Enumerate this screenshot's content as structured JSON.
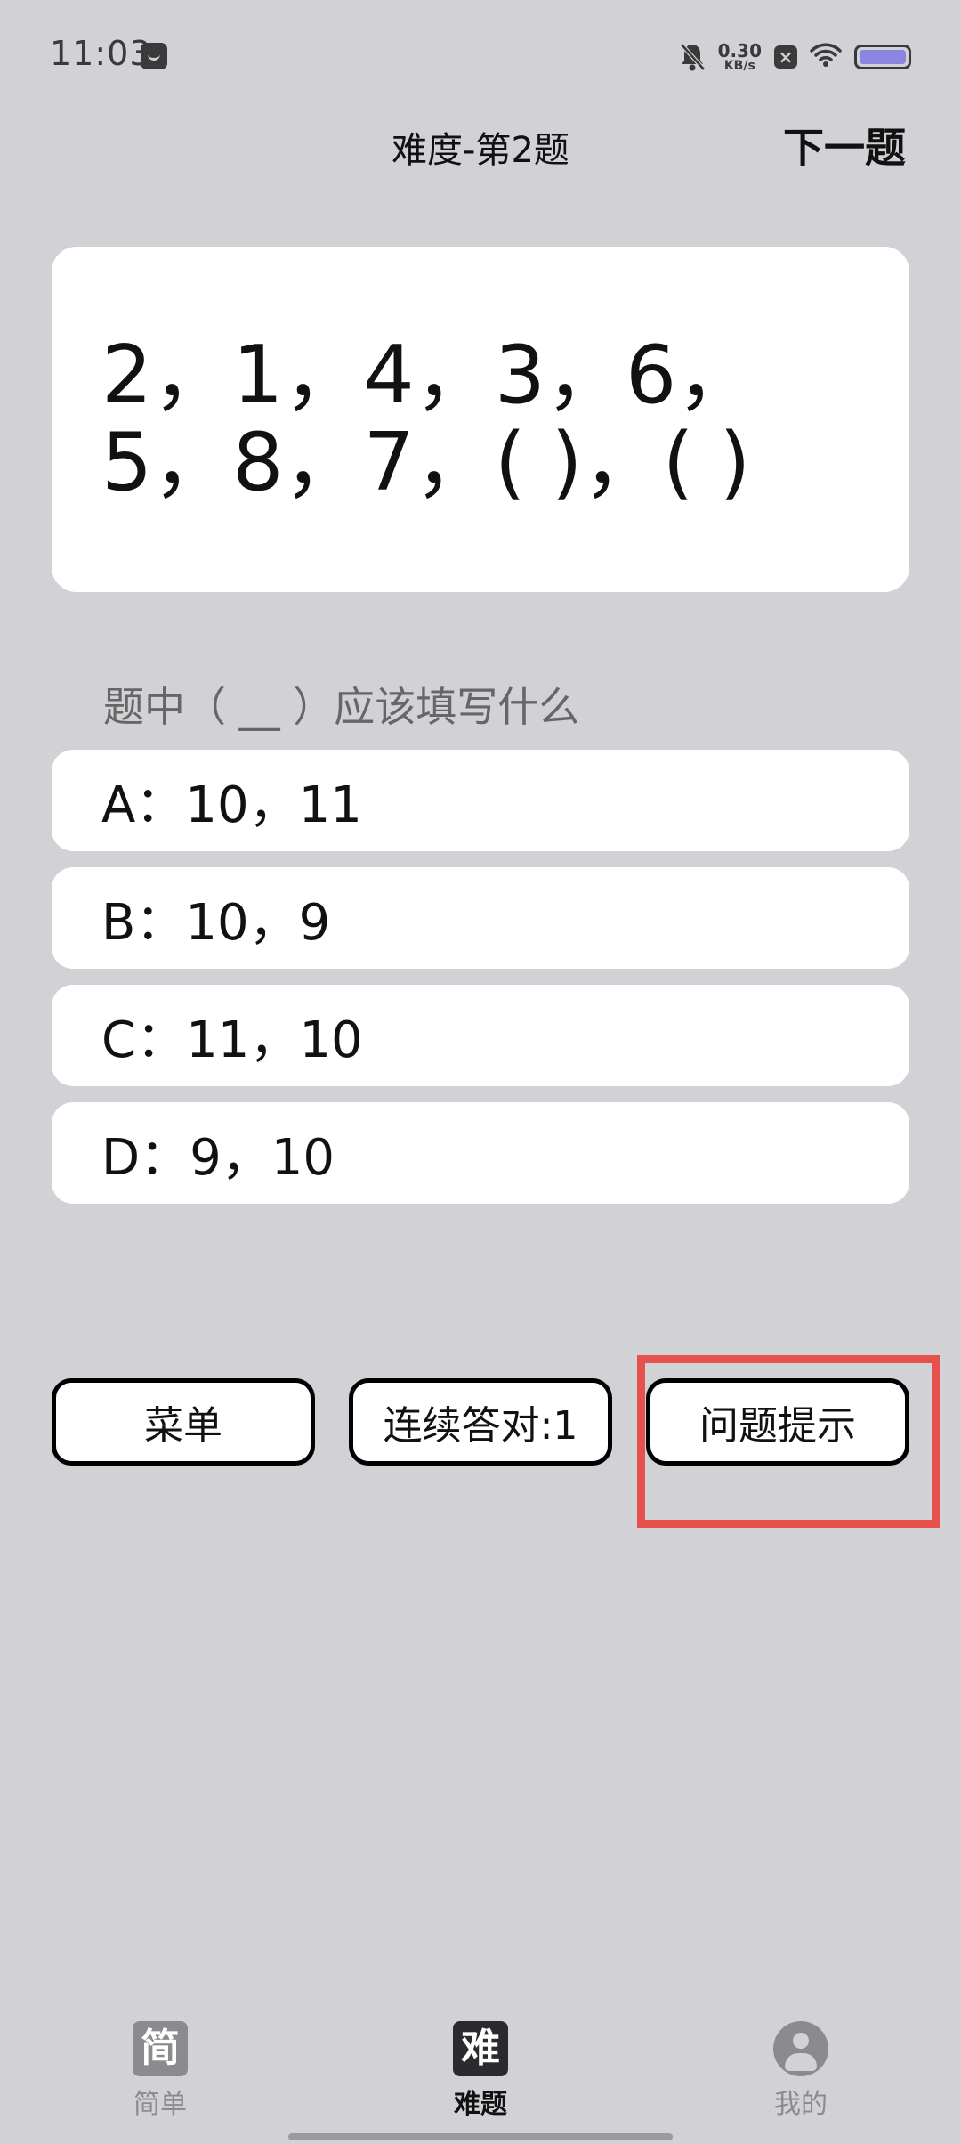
{
  "status_bar": {
    "time": "11:03",
    "net_speed_value": "0.30",
    "net_speed_unit": "KB/s",
    "battery_color": "#8a86e0"
  },
  "header": {
    "title": "难度-第2题",
    "next_label": "下一题"
  },
  "question": {
    "sequence": "2，1，4，3，6，5，8，7，( )，( )"
  },
  "prompt": "题中（ __ ）应该填写什么",
  "options": [
    {
      "label": "A：10，11"
    },
    {
      "label": "B：10，9"
    },
    {
      "label": "C：11，10"
    },
    {
      "label": "D：9，10"
    }
  ],
  "actions": {
    "menu_label": "菜单",
    "streak_label": "连续答对:1",
    "hint_label": "问题提示"
  },
  "highlight_color": "#e5514d",
  "bottom_nav": {
    "items": [
      {
        "icon_glyph": "简",
        "label": "简单",
        "icon": "easy-icon"
      },
      {
        "icon_glyph": "难",
        "label": "难题",
        "icon": "hard-icon"
      },
      {
        "label": "我的",
        "icon": "user-icon"
      }
    ],
    "active_index": 1
  }
}
